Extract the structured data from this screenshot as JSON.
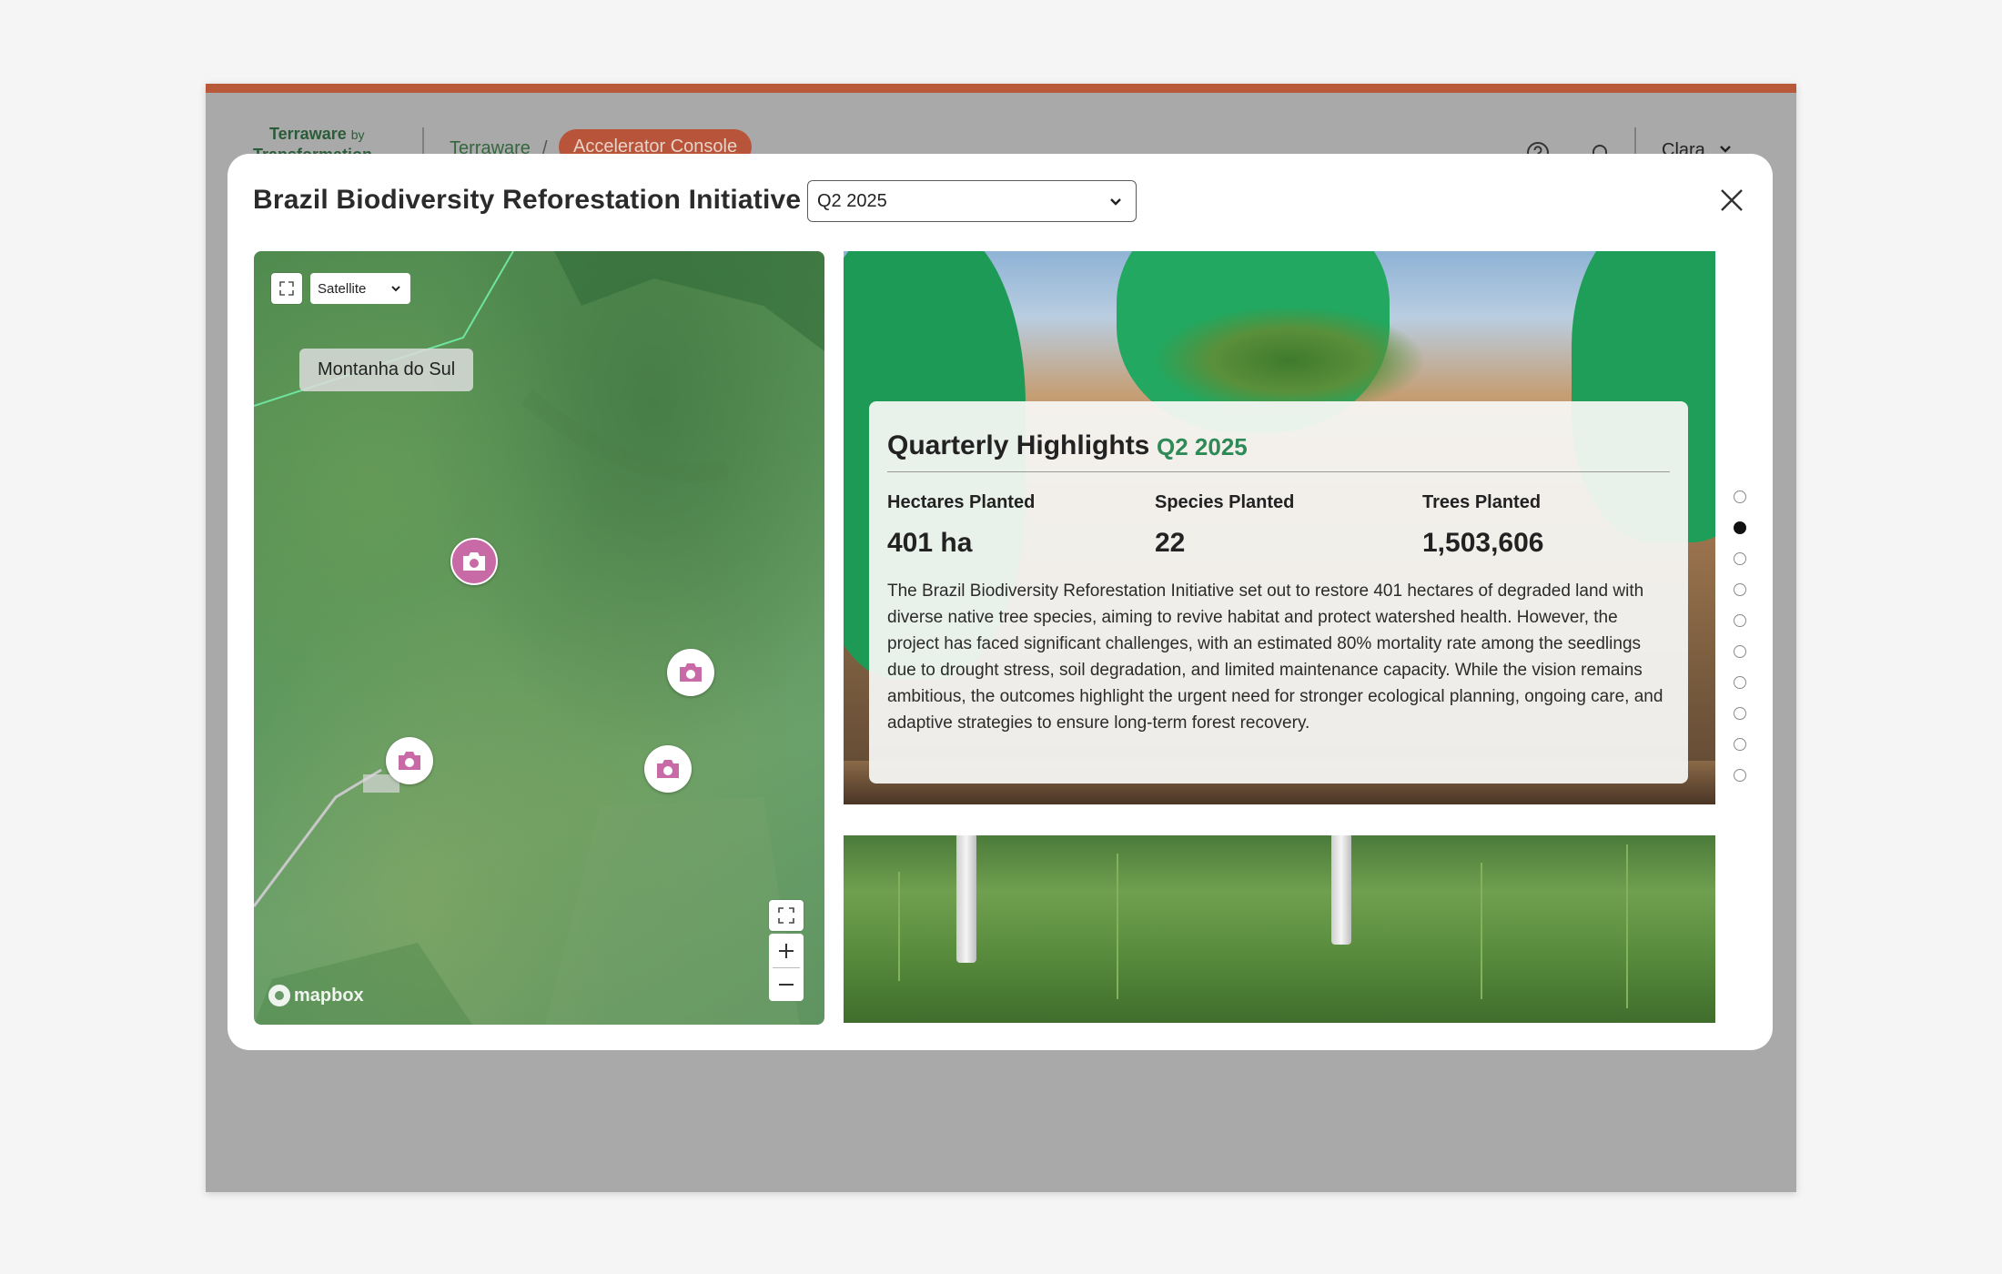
{
  "app": {
    "logo_text": "Terraware",
    "logo_by": "by",
    "logo_sub": "Transformation",
    "breadcrumb_home": "Terraware",
    "breadcrumb_sep": "/",
    "breadcrumb_current": "Accelerator Console",
    "user_name": "Clara"
  },
  "modal": {
    "title": "Brazil Biodiversity Reforestation Initiative",
    "period_select": "Q2 2025"
  },
  "map": {
    "map_type": "Satellite",
    "site_label": "Montanha do Sul",
    "attribution": "mapbox"
  },
  "highlights": {
    "title": "Quarterly Highlights",
    "period": "Q2 2025",
    "stats": [
      {
        "label": "Hectares Planted",
        "value": "401 ha"
      },
      {
        "label": "Species Planted",
        "value": "22"
      },
      {
        "label": "Trees Planted",
        "value": "1,503,606"
      }
    ],
    "body": "The Brazil Biodiversity Reforestation Initiative set out to restore 401 hectares of degraded land with diverse native tree species, aiming to revive habitat and protect watershed health. However, the project has faced significant challenges, with an estimated 80% mortality rate among the seedlings due to drought stress, soil degradation, and limited maintenance capacity. While the vision remains ambitious, the outcomes highlight the urgent need for stronger ecological planning, ongoing care, and adaptive strategies to ensure long-term forest recovery."
  },
  "pager": {
    "total": 10,
    "active_index": 1
  },
  "colors": {
    "accent_green": "#2e8b57",
    "header_accent": "#b85a3a",
    "marker_pink": "#c86aa6"
  }
}
